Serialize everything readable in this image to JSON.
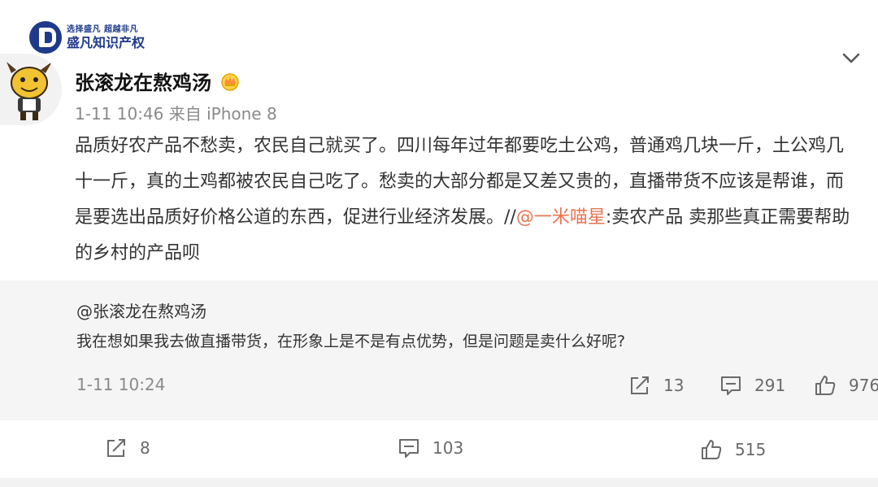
{
  "watermark": {
    "slogan": "选择盛凡 超越非凡",
    "name": "盛凡知识产权"
  },
  "post": {
    "username": "张滚龙在熬鸡汤",
    "badge_icon": "crown-badge-icon",
    "meta": "1-11 10:46 来自 iPhone 8",
    "content_main": "品质好农产品不愁卖，农民自己就买了。四川每年过年都要吃土公鸡，普通鸡几块一斤，土公鸡几十一斤，真的土鸡都被农民自己吃了。愁卖的大部分都是又差又贵的，直播带货不应该是帮谁，而是要选出品质好价格公道的东西，促进行业经济发展。//",
    "mention": "@一米喵星",
    "content_tail": ":卖农产品 卖那些真正需要帮助的乡村的产品呗"
  },
  "repost": {
    "user": "@张滚龙在熬鸡汤",
    "text": "我在想如果我去做直播带货，在形象上是不是有点优势，但是问题是卖什么好呢?",
    "time": "1-11 10:24",
    "share_count": "13",
    "comment_count": "291",
    "like_count": "976"
  },
  "actions": {
    "share_count": "8",
    "comment_count": "103",
    "like_count": "515"
  },
  "colors": {
    "mention": "#eb7350",
    "repost_bg": "#f5f5f5",
    "meta": "#8a8a8a",
    "brand": "#1f3a8a"
  }
}
